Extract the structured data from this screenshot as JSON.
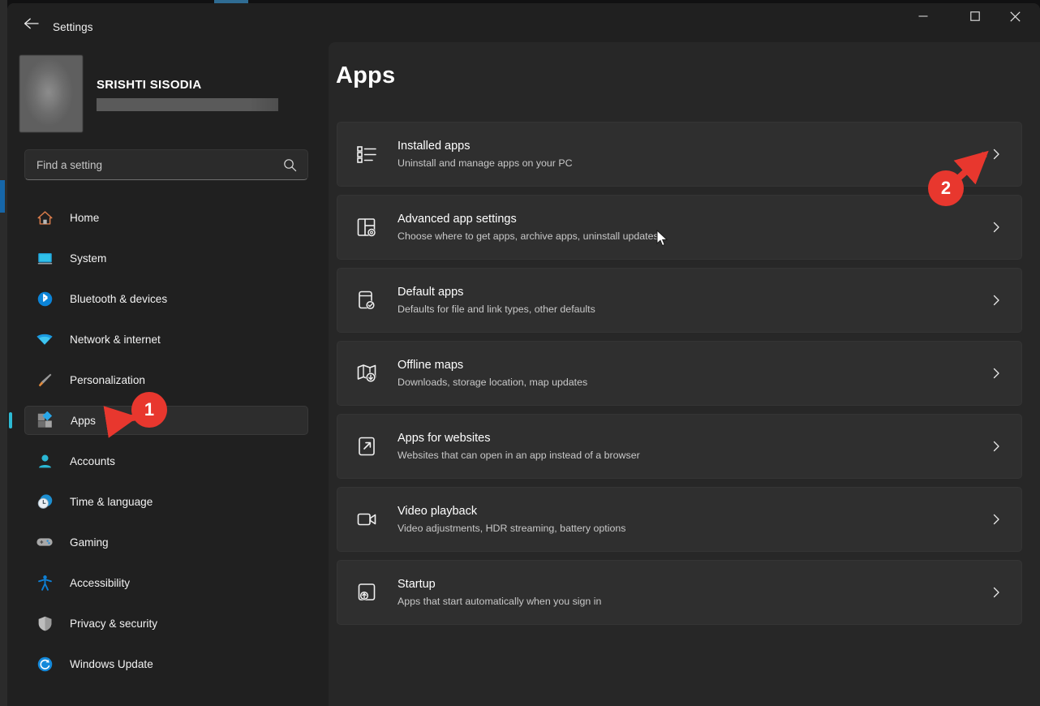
{
  "window": {
    "title": "Settings",
    "back_icon": "back-arrow-icon",
    "controls": {
      "minimize": "minimize-icon",
      "maximize": "maximize-icon",
      "close": "close-icon"
    }
  },
  "account": {
    "name": "SRISHTI SISODIA",
    "email_redacted": true
  },
  "search": {
    "placeholder": "Find a setting",
    "value": "",
    "icon": "search-icon"
  },
  "sidebar": {
    "items": [
      {
        "label": "Home",
        "icon": "home-icon",
        "selected": false
      },
      {
        "label": "System",
        "icon": "system-icon",
        "selected": false
      },
      {
        "label": "Bluetooth & devices",
        "icon": "bluetooth-icon",
        "selected": false
      },
      {
        "label": "Network & internet",
        "icon": "network-icon",
        "selected": false
      },
      {
        "label": "Personalization",
        "icon": "personalization-icon",
        "selected": false
      },
      {
        "label": "Apps",
        "icon": "apps-icon",
        "selected": true
      },
      {
        "label": "Accounts",
        "icon": "accounts-icon",
        "selected": false
      },
      {
        "label": "Time & language",
        "icon": "time-language-icon",
        "selected": false
      },
      {
        "label": "Gaming",
        "icon": "gaming-icon",
        "selected": false
      },
      {
        "label": "Accessibility",
        "icon": "accessibility-icon",
        "selected": false
      },
      {
        "label": "Privacy & security",
        "icon": "privacy-security-icon",
        "selected": false
      },
      {
        "label": "Windows Update",
        "icon": "windows-update-icon",
        "selected": false
      }
    ]
  },
  "main": {
    "title": "Apps",
    "cards": [
      {
        "title": "Installed apps",
        "subtitle": "Uninstall and manage apps on your PC",
        "icon": "installed-apps-icon",
        "chevron": "chevron-right-icon"
      },
      {
        "title": "Advanced app settings",
        "subtitle": "Choose where to get apps, archive apps, uninstall updates",
        "icon": "advanced-app-settings-icon",
        "chevron": "chevron-right-icon"
      },
      {
        "title": "Default apps",
        "subtitle": "Defaults for file and link types, other defaults",
        "icon": "default-apps-icon",
        "chevron": "chevron-right-icon"
      },
      {
        "title": "Offline maps",
        "subtitle": "Downloads, storage location, map updates",
        "icon": "offline-maps-icon",
        "chevron": "chevron-right-icon"
      },
      {
        "title": "Apps for websites",
        "subtitle": "Websites that can open in an app instead of a browser",
        "icon": "apps-for-websites-icon",
        "chevron": "chevron-right-icon"
      },
      {
        "title": "Video playback",
        "subtitle": "Video adjustments, HDR streaming, battery options",
        "icon": "video-playback-icon",
        "chevron": "chevron-right-icon"
      },
      {
        "title": "Startup",
        "subtitle": "Apps that start automatically when you sign in",
        "icon": "startup-icon",
        "chevron": "chevron-right-icon"
      }
    ]
  },
  "annotations": [
    {
      "number": "1",
      "target": "sidebar-item-apps"
    },
    {
      "number": "2",
      "target": "installed-apps-chevron"
    }
  ],
  "colors": {
    "accent_selection": "#2dbad4",
    "annotation_red": "#e8372e",
    "window_background": "#202020",
    "content_background": "#272727",
    "card_background": "#2f2f2f"
  }
}
